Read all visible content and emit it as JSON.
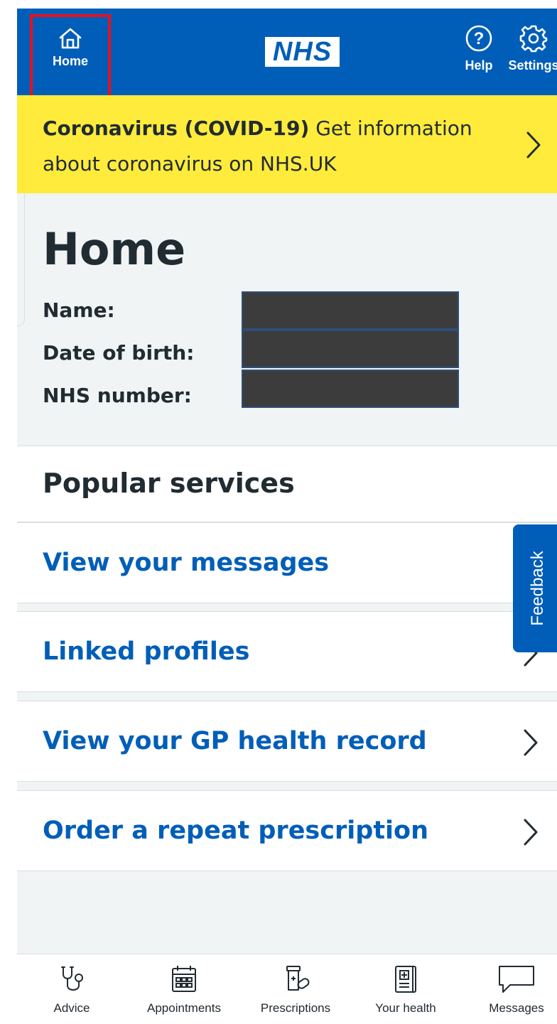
{
  "header": {
    "home_label": "Home",
    "logo_text": "NHS",
    "help_label": "Help",
    "settings_label": "Settings"
  },
  "banner": {
    "bold_text": "Coronavirus (COVID-19)",
    "text": " Get information about coronavirus on NHS.UK"
  },
  "home": {
    "title": "Home",
    "name_label": "Name:",
    "dob_label": "Date of birth:",
    "nhs_number_label": "NHS number:"
  },
  "popular": {
    "title": "Popular services",
    "items": [
      {
        "label": "View your messages"
      },
      {
        "label": "Linked profiles"
      },
      {
        "label": "View your GP health record"
      },
      {
        "label": "Order a repeat prescription"
      }
    ]
  },
  "feedback": {
    "label": "Feedback"
  },
  "tabbar": {
    "items": [
      {
        "label": "Advice",
        "icon": "stethoscope-icon"
      },
      {
        "label": "Appointments",
        "icon": "calendar-icon"
      },
      {
        "label": "Prescriptions",
        "icon": "pills-icon"
      },
      {
        "label": "Your health",
        "icon": "health-record-icon"
      },
      {
        "label": "Messages",
        "icon": "speech-bubble-icon"
      }
    ]
  },
  "colors": {
    "nhs_blue": "#005eb8",
    "banner_yellow": "#ffeb3b",
    "text_dark": "#212b32",
    "highlight_red": "#e8101c"
  }
}
